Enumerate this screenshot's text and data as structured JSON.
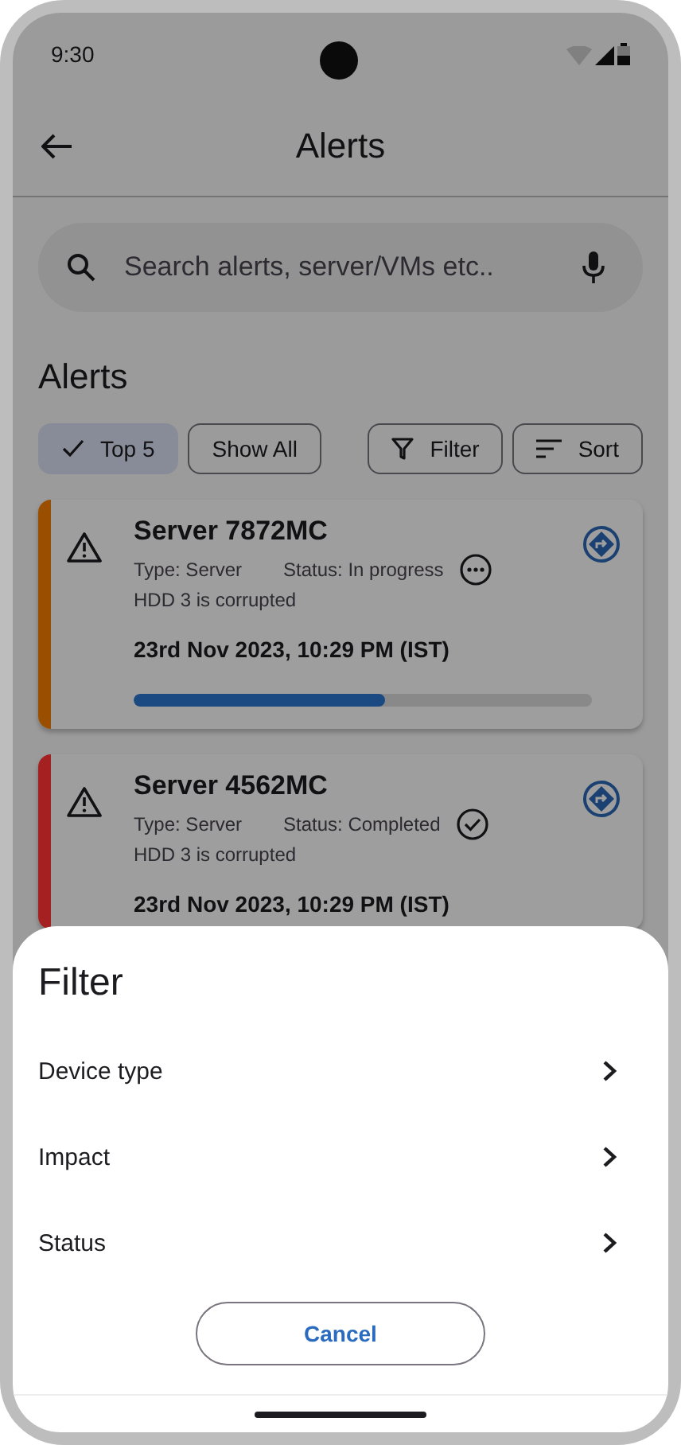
{
  "status_bar": {
    "time": "9:30"
  },
  "app_bar": {
    "title": "Alerts"
  },
  "search": {
    "placeholder": "Search alerts, server/VMs etc.."
  },
  "section_title": "Alerts",
  "chips": [
    {
      "label": "Top 5",
      "selected": true
    },
    {
      "label": "Show All",
      "selected": false
    }
  ],
  "actions": [
    {
      "kind": "filter",
      "label": "Filter"
    },
    {
      "kind": "sort",
      "label": "Sort"
    }
  ],
  "alerts": [
    {
      "title": "Server 7872MC",
      "type": "Type: Server",
      "status": "Status: In progress",
      "kind": "progress",
      "message": "HDD 3 is corrupted",
      "datetime": "23rd Nov 2023, 10:29 PM (IST)",
      "color": "#9a4f00",
      "level": 0.55
    },
    {
      "title": "Server 4562MC",
      "type": "Type: Server",
      "status": "Status: Completed",
      "kind": "done",
      "message": "HDD 3 is corrupted",
      "datetime": "23rd Nov 2023, 10:29 PM (IST)",
      "color": "#a52020"
    }
  ],
  "sheet": {
    "title": "Filter",
    "options": [
      "Device type",
      "Impact",
      "Status"
    ],
    "cancel": "Cancel"
  }
}
